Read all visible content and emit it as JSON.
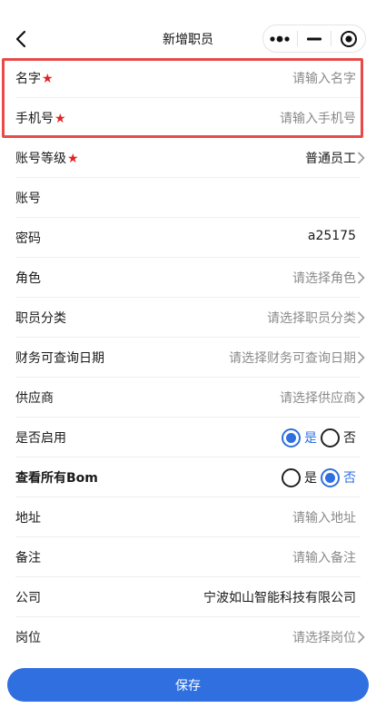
{
  "nav": {
    "title": "新增职员"
  },
  "form": {
    "name": {
      "label": "名字",
      "required": "★",
      "placeholder": "请输入名字"
    },
    "phone": {
      "label": "手机号",
      "required": "★",
      "placeholder": "请输入手机号"
    },
    "level": {
      "label": "账号等级",
      "required": "★",
      "value": "普通员工"
    },
    "account": {
      "label": "账号",
      "value": ""
    },
    "password": {
      "label": "密码",
      "value": "a25175"
    },
    "role": {
      "label": "角色",
      "placeholder": "请选择角色"
    },
    "category": {
      "label": "职员分类",
      "placeholder": "请选择职员分类"
    },
    "finance_date": {
      "label": "财务可查询日期",
      "placeholder": "请选择财务可查询日期"
    },
    "supplier": {
      "label": "供应商",
      "placeholder": "请选择供应商"
    },
    "enabled": {
      "label": "是否启用",
      "yes": "是",
      "no": "否",
      "selected": "是"
    },
    "view_bom": {
      "label": "查看所有Bom",
      "yes": "是",
      "no": "否",
      "selected": "否"
    },
    "address": {
      "label": "地址",
      "placeholder": "请输入地址"
    },
    "remark": {
      "label": "备注",
      "placeholder": "请输入备注"
    },
    "company": {
      "label": "公司",
      "value": "宁波如山智能科技有限公司"
    },
    "post": {
      "label": "岗位",
      "placeholder": "请选择岗位"
    }
  },
  "footer": {
    "save_label": "保存"
  },
  "colors": {
    "accent": "#2f6fe0",
    "required_star": "#e02424",
    "highlight": "#e84a4a"
  },
  "icons": {
    "back": "chevron-left-icon",
    "more": "more-dots-icon",
    "minimize": "minimize-icon",
    "close": "target-close-icon",
    "arrow": "chevron-right-icon"
  }
}
